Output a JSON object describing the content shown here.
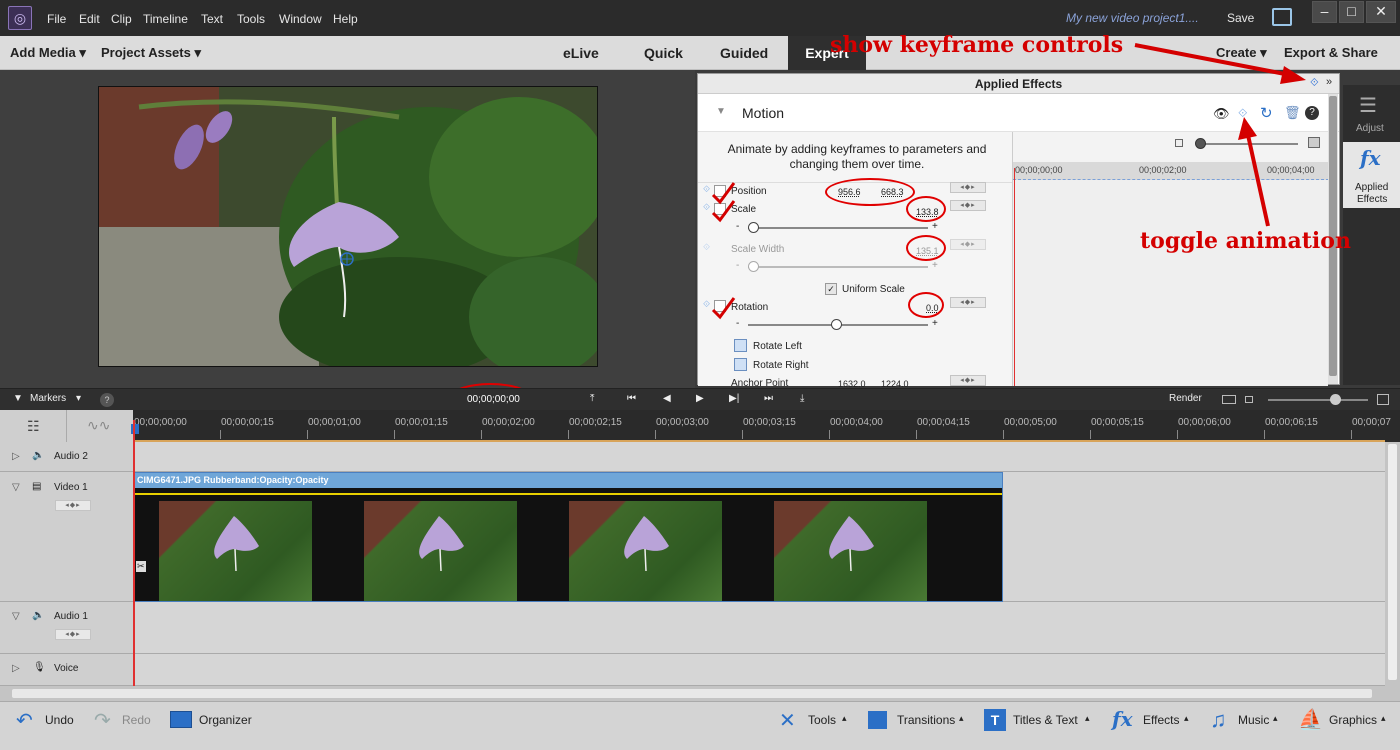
{
  "app": {
    "menu": [
      "File",
      "Edit",
      "Clip",
      "Timeline",
      "Text",
      "Tools",
      "Window",
      "Help"
    ],
    "project_title": "My new video project1....",
    "save_label": "Save"
  },
  "modebar": {
    "add_media": "Add Media",
    "project_assets": "Project Assets",
    "tabs": [
      "eLive",
      "Quick",
      "Guided",
      "Expert"
    ],
    "create": "Create",
    "export_share": "Export & Share"
  },
  "effects_panel": {
    "title": "Applied Effects",
    "section": "Motion",
    "description": "Animate by adding keyframes to parameters and changing them over time.",
    "params": {
      "position": {
        "label": "Position",
        "x": "956.6",
        "y": "668.3"
      },
      "scale": {
        "label": "Scale",
        "value": "133.8"
      },
      "scale_width": {
        "label": "Scale Width",
        "value": "135.1"
      },
      "uniform_scale": "Uniform Scale",
      "rotation": {
        "label": "Rotation",
        "value": "0.0"
      },
      "rotate_left": "Rotate Left",
      "rotate_right": "Rotate Right",
      "anchor_point": {
        "label": "Anchor Point",
        "x": "1632.0",
        "y": "1224.0"
      }
    },
    "mini_ticks": [
      "00;00;00;00",
      "00;00;02;00",
      "00;00;04;00"
    ]
  },
  "sidepanel": {
    "adjust": "Adjust",
    "fx_glyph": "fx",
    "applied_effects_l1": "Applied",
    "applied_effects_l2": "Effects"
  },
  "annotations": {
    "show_keyframe": "show keyframe controls",
    "toggle_animation": "toggle animation"
  },
  "transport": {
    "markers": "Markers",
    "timecode": "00;00;00;00",
    "render": "Render"
  },
  "timeline": {
    "ticks": [
      "00;00;00;00",
      "00;00;00;15",
      "00;00;01;00",
      "00;00;01;15",
      "00;00;02;00",
      "00;00;02;15",
      "00;00;03;00",
      "00;00;03;15",
      "00;00;04;00",
      "00;00;04;15",
      "00;00;05;00",
      "00;00;05;15",
      "00;00;06;00",
      "00;00;06;15",
      "00;00;07"
    ],
    "tracks": {
      "audio2": "Audio 2",
      "video1": "Video 1",
      "audio1": "Audio 1",
      "voice": "Voice"
    },
    "clip_label": "CIMG6471.JPG Rubberband:Opacity:Opacity"
  },
  "bottombar": {
    "undo": "Undo",
    "redo": "Redo",
    "organizer": "Organizer",
    "tools": "Tools",
    "transitions": "Transitions",
    "titles_text": "Titles & Text",
    "effects": "Effects",
    "music": "Music",
    "graphics": "Graphics"
  },
  "colors": {
    "annotation_red": "#d40000",
    "clip_blue": "#6fa6d8",
    "playhead_red": "#e03030"
  }
}
